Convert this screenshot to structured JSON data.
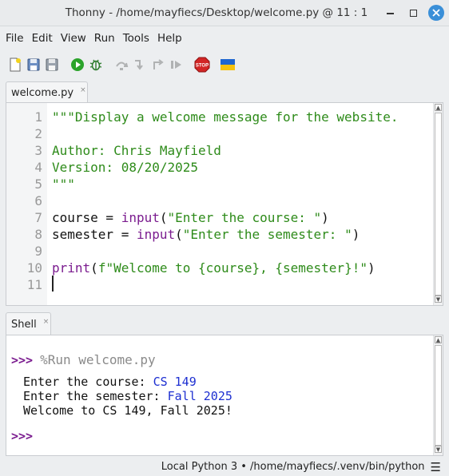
{
  "window": {
    "title": "Thonny  -  /home/mayfiecs/Desktop/welcome.py  @  11 : 1",
    "minimize_icon": "minimize-icon",
    "maximize_icon": "maximize-icon",
    "close_icon": "close-icon"
  },
  "menu": [
    "File",
    "Edit",
    "View",
    "Run",
    "Tools",
    "Help"
  ],
  "toolbar": {
    "buttons": [
      "new-file-icon",
      "save-icon",
      "save-as-icon",
      "run-icon",
      "debug-icon",
      "step-over-icon",
      "step-into-icon",
      "step-out-icon",
      "resume-icon",
      "stop-icon",
      "ukraine-flag-icon"
    ],
    "colors": {
      "run": "#2ba32b",
      "stop": "#d22525",
      "flag_blue": "#1e66d0",
      "flag_yellow": "#f6c20d"
    }
  },
  "editor": {
    "tab_label": "welcome.py",
    "tab_close": "×",
    "line_numbers": [
      "1",
      "2",
      "3",
      "4",
      "5",
      "6",
      "7",
      "8",
      "9",
      "10",
      "11"
    ],
    "lines": [
      "\"\"\"Display a welcome message for the website.",
      "",
      "Author: Chris Mayfield",
      "Version: 08/20/2025",
      "\"\"\"",
      "",
      "course = input(\"Enter the course: \")",
      "semester = input(\"Enter the semester: \")",
      "",
      "print(f\"Welcome to {course}, {semester}!\")",
      ""
    ],
    "tokens": {
      "line7": {
        "var": "course = ",
        "fn": "input",
        "open": "(",
        "str": "\"Enter the course: \"",
        "close": ")"
      },
      "line8": {
        "var": "semester = ",
        "fn": "input",
        "open": "(",
        "str": "\"Enter the semester: \"",
        "close": ")"
      },
      "line10": {
        "fn": "print",
        "open": "(",
        "str": "f\"Welcome to {course}, {semester}!\"",
        "close": ")"
      }
    },
    "colors": {
      "string": "#2e8b1a",
      "builtin": "#7b1c8f",
      "line_number": "#999999"
    }
  },
  "shell": {
    "tab_label": "Shell",
    "tab_close": "×",
    "prompt": ">>>",
    "run_command": "%Run welcome.py",
    "output": [
      {
        "text": "Enter the course: ",
        "input": "CS 149"
      },
      {
        "text": "Enter the semester: ",
        "input": "Fall 2025"
      },
      {
        "text": "Welcome to CS 149, Fall 2025!",
        "input": ""
      }
    ],
    "final_prompt": ">>>"
  },
  "statusbar": {
    "interpreter": "Local Python 3  •  /home/mayfiecs/.venv/bin/python",
    "menu_icon": "☰"
  }
}
